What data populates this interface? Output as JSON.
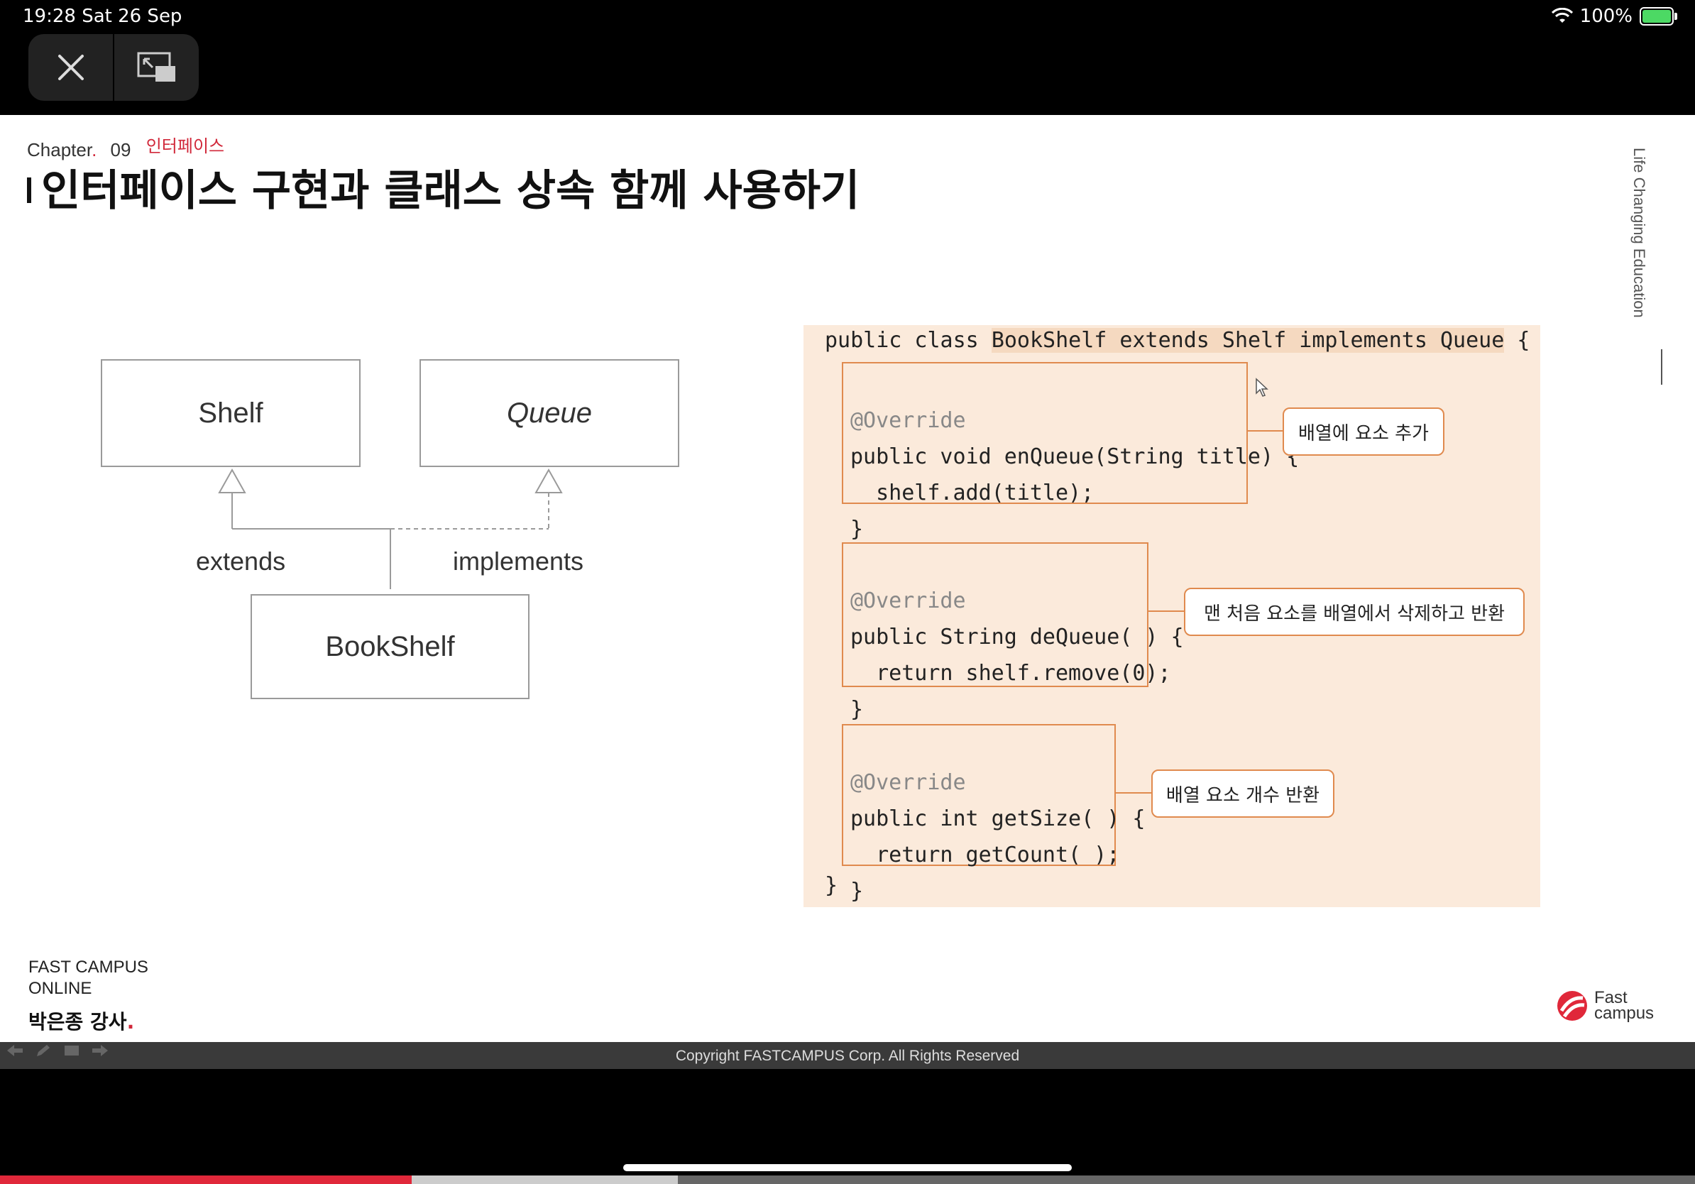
{
  "status_bar": {
    "time_date": "19:28   Sat 26 Sep",
    "battery": "100%"
  },
  "controls": {
    "close": "close",
    "pip": "picture-in-picture"
  },
  "slide": {
    "chapter_label": "Chapter",
    "chapter_dot": ".",
    "chapter_num": "09",
    "chapter_topic": "인터페이스",
    "title": "인터페이스 구현과 클래스 상속 함께 사용하기",
    "sidebar_text": "Life Changing Education",
    "uml": {
      "shelf": "Shelf",
      "queue": "Queue",
      "bookshelf": "BookShelf",
      "extends": "extends",
      "implements": "implements"
    },
    "code": {
      "class_prefix": "public class ",
      "class_highlight": "BookShelf extends Shelf implements Queue",
      "class_suffix": " {",
      "m1_anno": "@Override",
      "m1_l1": "public void enQueue(String title) {",
      "m1_l2": "  shelf.add(title);",
      "m1_l3": "}",
      "m2_anno": "@Override",
      "m2_l1": "public String deQueue( ) {",
      "m2_l2": "  return shelf.remove(0);",
      "m2_l3": "}",
      "m3_anno": "@Override",
      "m3_l1": "public int getSize( ) {",
      "m3_l2": "  return getCount( );",
      "m3_l3": "}",
      "closing": "}",
      "callout1": "배열에 요소 추가",
      "callout2": "맨 처음 요소를 배열에서 삭제하고 반환",
      "callout3": "배열 요소 개수 반환"
    },
    "footer": {
      "brand_line1": "FAST  CAMPUS",
      "brand_line2": "ONLINE",
      "instructor": "박은종 강사",
      "instructor_dot": ".",
      "logo_line1": "Fast",
      "logo_line2": "campus"
    },
    "copyright": "Copyright  FASTCAMPUS  Corp.  All  Rights  Reserved"
  },
  "playback": {
    "played_fraction": 0.243,
    "buffered_fraction": 0.4
  },
  "colors": {
    "accent": "#e0283a",
    "code_bg": "#fbeadb",
    "code_border": "#e08a4e"
  }
}
